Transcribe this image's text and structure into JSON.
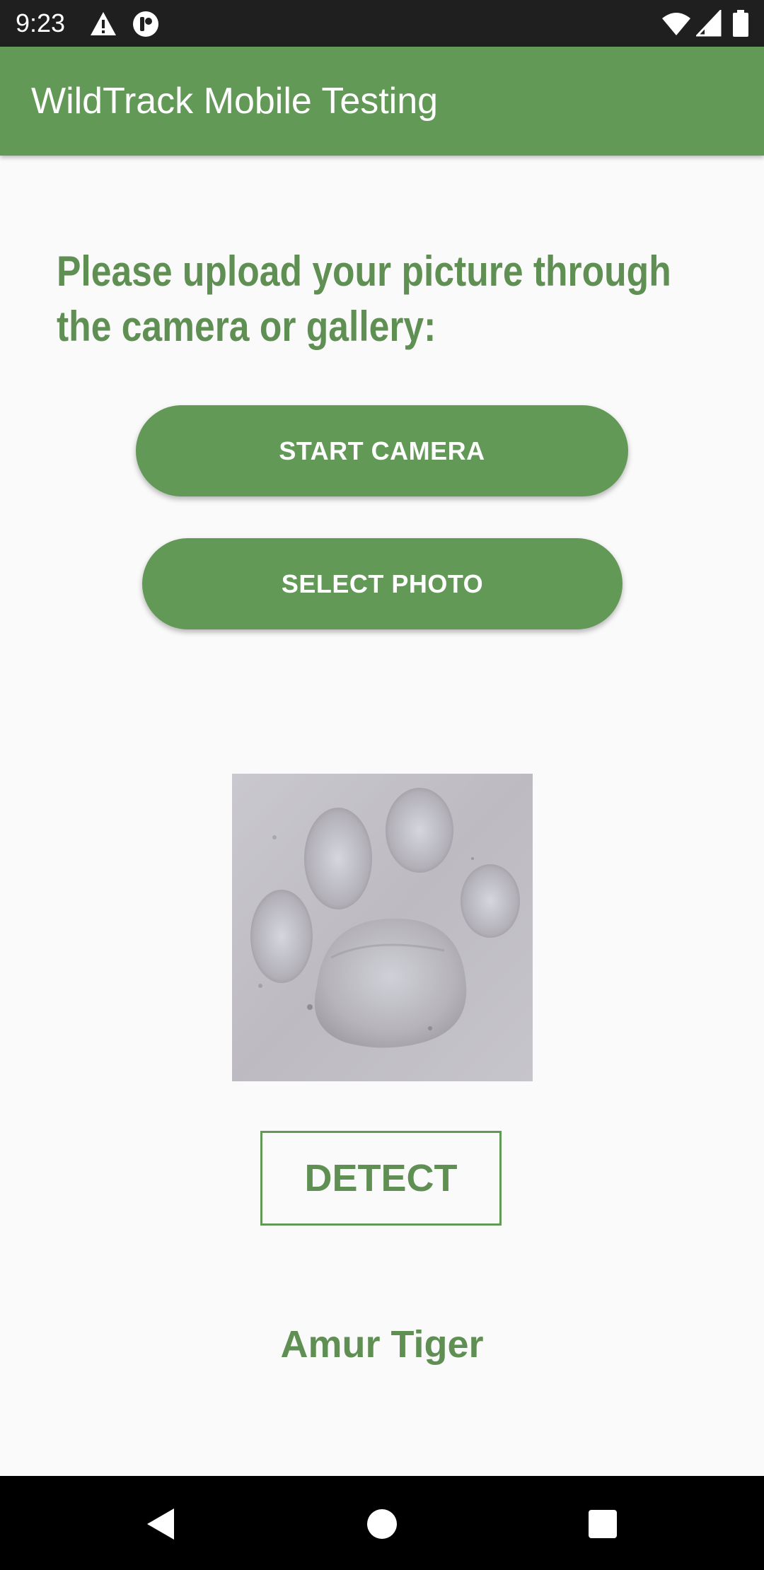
{
  "status_bar": {
    "time": "9:23",
    "left_icons": [
      "warning-icon",
      "notification-app-icon"
    ],
    "right_icons": [
      "wifi-icon",
      "cell-signal-icon",
      "battery-icon"
    ]
  },
  "app_bar": {
    "title": "WildTrack Mobile Testing",
    "color": "#639957"
  },
  "main": {
    "prompt_line1": "Please upload your picture through",
    "prompt_line2": "the camera or gallery:",
    "start_camera_label": "START CAMERA",
    "select_photo_label": "SELECT PHOTO",
    "detect_label": "DETECT",
    "result_text": "Amur Tiger",
    "accent_color": "#639957"
  },
  "nav_bar": {
    "icons": [
      "back-icon",
      "home-icon",
      "recents-icon"
    ]
  }
}
